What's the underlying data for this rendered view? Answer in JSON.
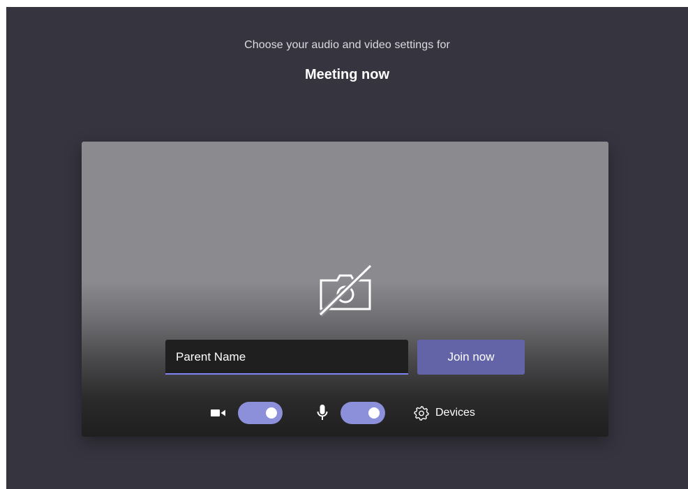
{
  "header": {
    "subtitle": "Choose your audio and video settings for",
    "meeting_title": "Meeting now"
  },
  "preview": {
    "camera_state_icon": "camera-off-icon"
  },
  "join_form": {
    "name_value": "Parent Name",
    "join_label": "Join now"
  },
  "controls": {
    "camera_icon": "video-camera-icon",
    "camera_enabled": true,
    "mic_icon": "microphone-icon",
    "mic_enabled": true,
    "devices_icon": "gear-icon",
    "devices_label": "Devices"
  },
  "colors": {
    "background": "#36343f",
    "accent": "#6264a7",
    "toggle_on": "#8c8fd9",
    "input_underline": "#7f85f5"
  }
}
